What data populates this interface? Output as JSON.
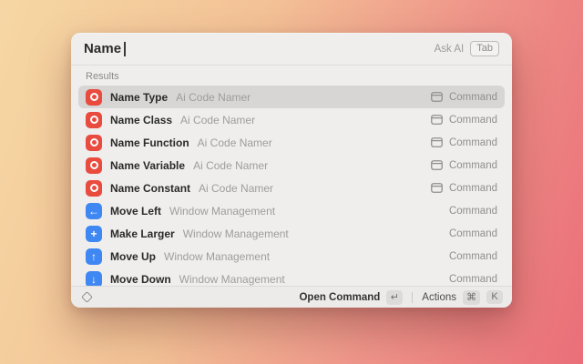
{
  "window": {
    "search": {
      "value": "Name",
      "ask_ai_label": "Ask AI",
      "tab_key_label": "Tab"
    },
    "results_header": "Results",
    "items": [
      {
        "title": "Name Type",
        "subtitle": "Ai Code Namer",
        "icon": "lifebuoy-red",
        "accessory_icon": true,
        "accessory": "Command",
        "selected": true
      },
      {
        "title": "Name Class",
        "subtitle": "Ai Code Namer",
        "icon": "lifebuoy-red",
        "accessory_icon": true,
        "accessory": "Command",
        "selected": false
      },
      {
        "title": "Name Function",
        "subtitle": "Ai Code Namer",
        "icon": "lifebuoy-red",
        "accessory_icon": true,
        "accessory": "Command",
        "selected": false
      },
      {
        "title": "Name Variable",
        "subtitle": "Ai Code Namer",
        "icon": "lifebuoy-red",
        "accessory_icon": true,
        "accessory": "Command",
        "selected": false
      },
      {
        "title": "Name Constant",
        "subtitle": "Ai Code Namer",
        "icon": "lifebuoy-red",
        "accessory_icon": true,
        "accessory": "Command",
        "selected": false
      },
      {
        "title": "Move Left",
        "subtitle": "Window Management",
        "icon": "arrow-left-blue",
        "accessory_icon": false,
        "accessory": "Command",
        "selected": false
      },
      {
        "title": "Make Larger",
        "subtitle": "Window Management",
        "icon": "plus-blue",
        "accessory_icon": false,
        "accessory": "Command",
        "selected": false
      },
      {
        "title": "Move Up",
        "subtitle": "Window Management",
        "icon": "arrow-up-blue",
        "accessory_icon": false,
        "accessory": "Command",
        "selected": false
      },
      {
        "title": "Move Down",
        "subtitle": "Window Management",
        "icon": "arrow-down-blue",
        "accessory_icon": false,
        "accessory": "Command",
        "selected": false
      }
    ],
    "footer": {
      "primary_action": "Open Command",
      "primary_key": "↵",
      "actions_label": "Actions",
      "actions_keys": [
        "⌘",
        "K"
      ]
    }
  },
  "icon_glyphs": {
    "arrow-left-blue": "←",
    "plus-blue": "+",
    "arrow-up-blue": "↑",
    "arrow-down-blue": "↓"
  },
  "colors": {
    "icon_red": "#e94b3f",
    "icon_blue": "#3f87f2",
    "selected_row": "#d7d6d4",
    "window_bg": "#efeeec",
    "bg_gradient_start": "#f6d7a4",
    "bg_gradient_end": "#ea6e78"
  }
}
